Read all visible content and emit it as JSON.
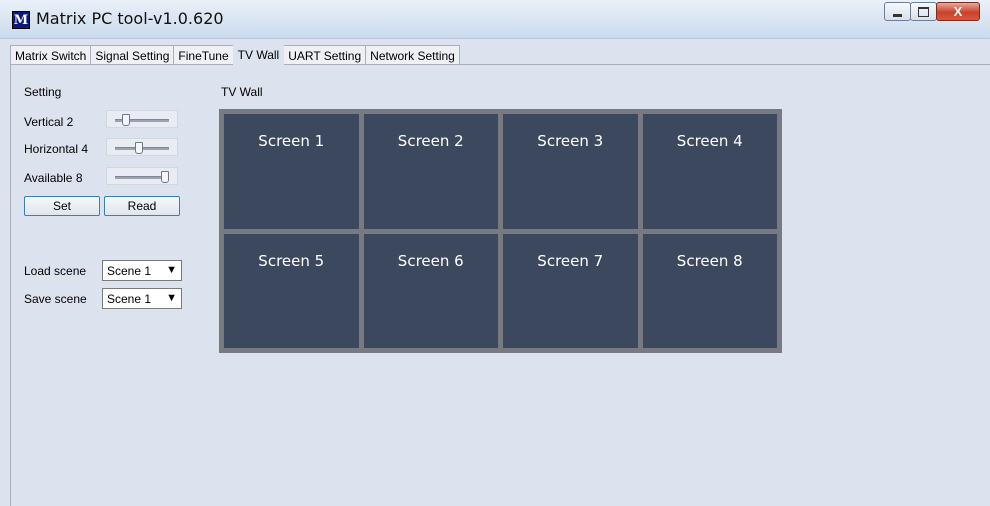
{
  "window": {
    "title": "Matrix PC tool-v1.0.620",
    "close_glyph": "X"
  },
  "tabs": [
    {
      "label": "Matrix Switch",
      "active": false
    },
    {
      "label": "Signal Setting",
      "active": false
    },
    {
      "label": "FineTune",
      "active": false
    },
    {
      "label": "TV Wall",
      "active": true
    },
    {
      "label": "UART Setting",
      "active": false
    },
    {
      "label": "Network Setting",
      "active": false
    }
  ],
  "settings": {
    "heading": "Setting",
    "vertical": {
      "label": "Vertical 2",
      "value": 2,
      "max": 8
    },
    "horizontal": {
      "label": "Horizontal 4",
      "value": 4,
      "max": 8
    },
    "available": {
      "label": "Available 8",
      "value": 8,
      "max": 8
    },
    "set_label": "Set",
    "read_label": "Read"
  },
  "scene": {
    "load_label": "Load scene",
    "load_value": "Scene 1",
    "save_label": "Save scene",
    "save_value": "Scene 1"
  },
  "tvwall": {
    "heading": "TV Wall",
    "screens": [
      "Screen 1",
      "Screen 2",
      "Screen 3",
      "Screen 4",
      "Screen 5",
      "Screen 6",
      "Screen 7",
      "Screen 8"
    ]
  },
  "colors": {
    "screen_bg": "#3c485d",
    "wall_border": "#777a80",
    "panel_bg": "#dde3ee"
  }
}
